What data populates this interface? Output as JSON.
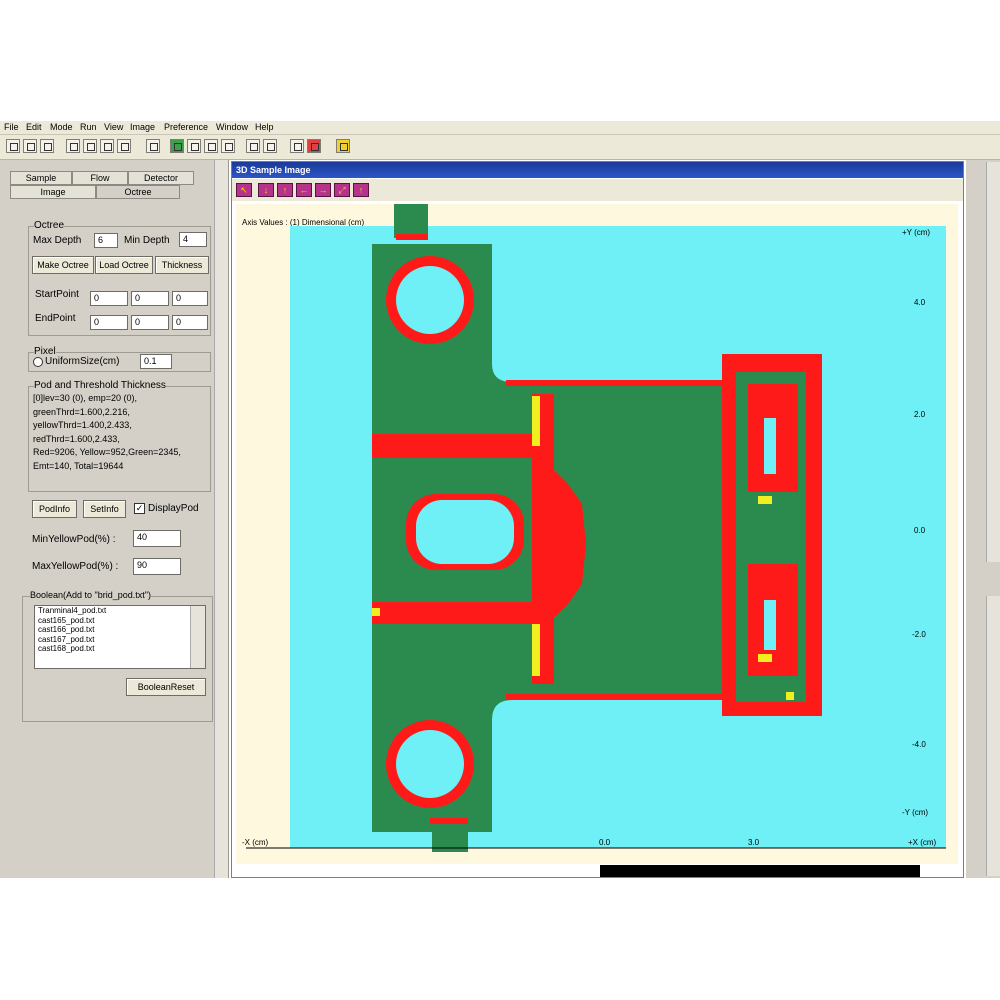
{
  "menu": [
    "File",
    "Edit",
    "Mode",
    "Run",
    "View",
    "Image",
    "Preference",
    "Window",
    "Help"
  ],
  "left_panel": {
    "tabs_row1": [
      "Sample",
      "Flow",
      "Detector"
    ],
    "tabs_row2": [
      "Image",
      "Octree"
    ],
    "octree_group_label": "Octree",
    "max_depth_label": "Max Depth",
    "max_depth_value": "6",
    "min_depth_label": "Min Depth",
    "min_depth_value": "4",
    "make_octree_button": "Make Octree",
    "load_octree_button": "Load Octree",
    "thickness_button": "Thickness",
    "start_point_label": "StartPoint",
    "start_point": [
      "0",
      "0",
      "0"
    ],
    "end_point_label": "EndPoint",
    "end_point": [
      "0",
      "0",
      "0"
    ],
    "pixel_group_label": "Pixel",
    "uniform_size_label": "UniformSize(cm)",
    "uniform_size_value": "0.1",
    "thickness_group_label": "Pod and Threshold Thickness",
    "thickness_lines": [
      "[0]lev=30 (0), emp=20 (0),",
      "greenThrd=1.600,2.216,",
      "yellowThrd=1.400,2.433,",
      "redThrd=1.600,2.433,",
      "Red=9206, Yellow=952,Green=2345,",
      "Emt=140, Total=19644"
    ],
    "pod_info_button": "PodInfo",
    "set_info_button": "SetInfo",
    "display_pod_label": "DisplayPod",
    "min_yellow_label": "MinYellowPod(%) :",
    "min_yellow_value": "40",
    "max_yellow_label": "MaxYellowPod(%) :",
    "max_yellow_value": "90",
    "boolean_group_label": "Boolean(Add to \"brid_pod.txt\")",
    "boolean_files": [
      "Tranminal4_pod.txt",
      "cast165_pod.txt",
      "cast166_pod.txt",
      "cast167_pod.txt",
      "cast168_pod.txt"
    ],
    "boolean_reset_button": "BooleanReset"
  },
  "window": {
    "title": "3D Sample Image",
    "plot_caption": "Axis Values : (1) Dimensional (cm)",
    "y_axis_top_label": "+Y (cm)",
    "y_axis_bottom_label": "-Y (cm)",
    "x_axis_left_label": "-X (cm)",
    "x_axis_right_label": "+X (cm)",
    "y_ticks": [
      "4.0",
      "2.0",
      "0.0",
      "-2.0",
      "-4.0"
    ],
    "x_ticks": [
      "0.0",
      "3.0"
    ]
  },
  "colors": {
    "background_cyan": "#6ef0f6",
    "part_green": "#2b8a4e",
    "pod_red": "#ff1a1a",
    "pod_yellow": "#f0f020",
    "plot_cream": "#fdf8de"
  }
}
